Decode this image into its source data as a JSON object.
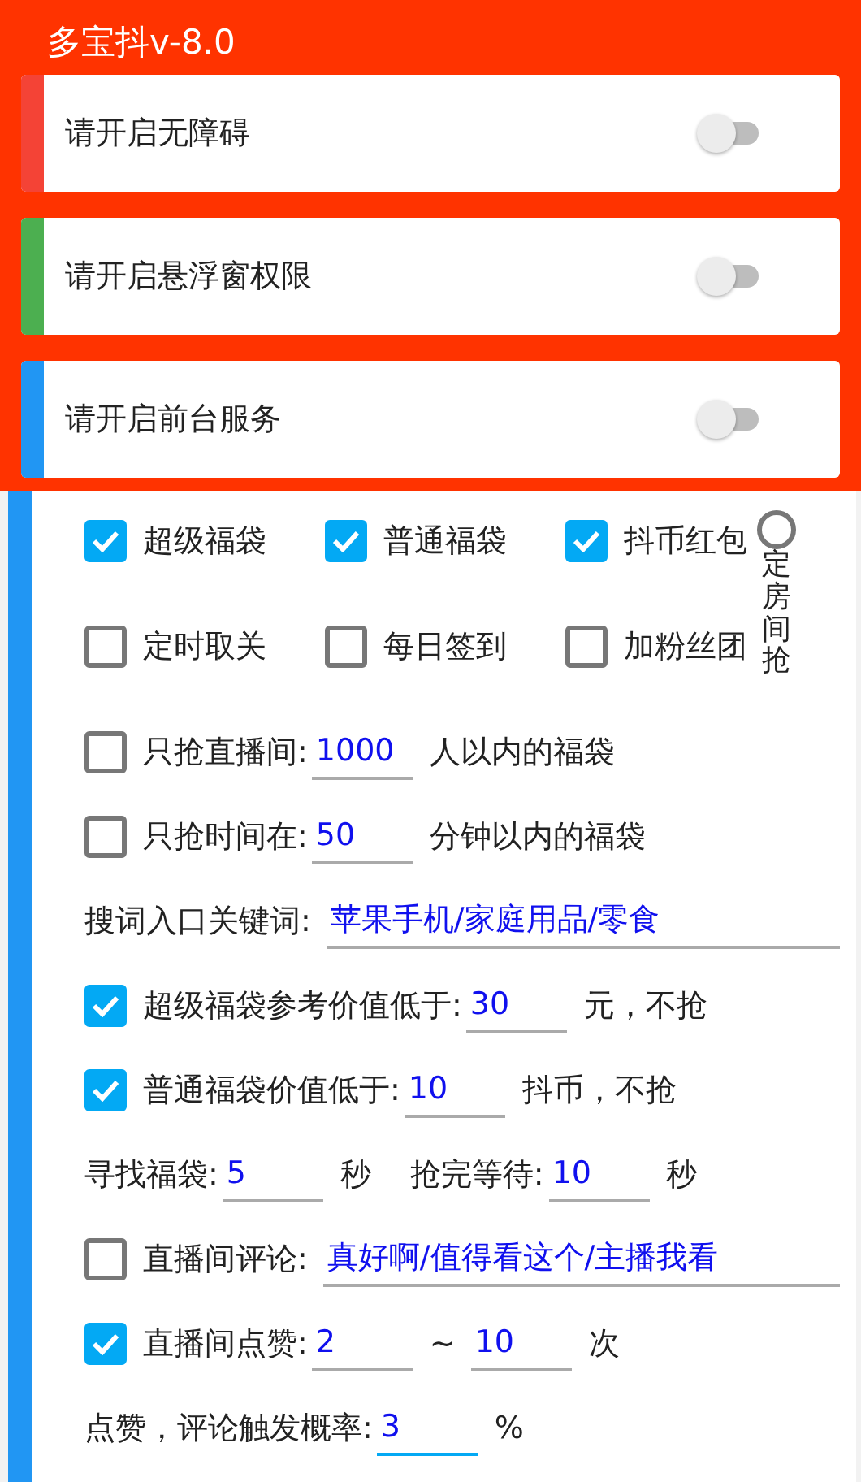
{
  "app_title": "多宝抖v-8.0",
  "permissions": [
    {
      "label": "请开启无障碍",
      "on": false,
      "color": "#f44336"
    },
    {
      "label": "请开启悬浮窗权限",
      "on": false,
      "color": "#4caf50"
    },
    {
      "label": "请开启前台服务",
      "on": false,
      "color": "#2196f3"
    }
  ],
  "options": [
    {
      "label": "超级福袋",
      "checked": true
    },
    {
      "label": "普通福袋",
      "checked": true
    },
    {
      "label": "抖币红包",
      "checked": true
    },
    {
      "label": "定时取关",
      "checked": false
    },
    {
      "label": "每日签到",
      "checked": false
    },
    {
      "label": "加粉丝团",
      "checked": false
    }
  ],
  "room_radio": {
    "label": "定房间抢",
    "selected": false
  },
  "settings": [
    {
      "kind": "check_field",
      "checked": false,
      "label": "只抢直播间:",
      "value": "1000",
      "suffix": "人以内的福袋"
    },
    {
      "kind": "check_field",
      "checked": false,
      "label": "只抢时间在:",
      "value": "50",
      "suffix": "分钟以内的福袋"
    },
    {
      "kind": "wide_field",
      "label": "搜词入口关键词:",
      "value": "苹果手机/家庭用品/零食"
    },
    {
      "kind": "check_field",
      "checked": true,
      "label": "超级福袋参考价值低于:",
      "value": "30",
      "suffix": "元，不抢"
    },
    {
      "kind": "check_field",
      "checked": true,
      "label": "普通福袋价值低于:",
      "value": "10",
      "suffix": "抖币，不抢"
    },
    {
      "kind": "pair",
      "items": [
        {
          "label": "寻找福袋:",
          "value": "5",
          "unit": "秒"
        },
        {
          "label": "抢完等待:",
          "value": "10",
          "unit": "秒"
        }
      ]
    },
    {
      "kind": "check_wide_field",
      "checked": false,
      "label": "直播间评论:",
      "value": "真好啊/值得看这个/主播我看"
    },
    {
      "kind": "check_range",
      "checked": true,
      "label": "直播间点赞:",
      "from": "2",
      "separator": "~",
      "to": "10",
      "unit": "次"
    },
    {
      "kind": "field",
      "focused": true,
      "label": "点赞，评论触发概率:",
      "value": "3",
      "suffix": "%"
    }
  ]
}
